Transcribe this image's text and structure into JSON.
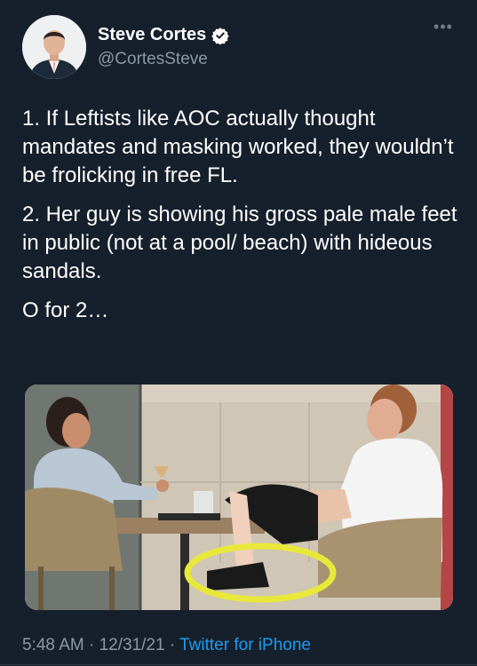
{
  "author": {
    "display_name": "Steve Cortes",
    "handle": "@CortesSteve",
    "verified": true,
    "verified_icon": "verified-badge-icon"
  },
  "tweet": {
    "paragraphs": [
      "1. If Leftists like AOC actually thought mandates and masking worked, they wouldn’t be frolicking in free FL.",
      "2. Her guy is showing his gross pale male feet in public (not at a pool/ beach) with hideous sandals.",
      "O for 2…"
    ]
  },
  "meta": {
    "time": "5:48 AM",
    "sep1": " · ",
    "date": "12/31/21",
    "sep2": " · ",
    "source": "Twitter for iPhone"
  },
  "colors": {
    "background": "#16202c",
    "secondary_text": "#8b98a5",
    "link": "#1d9bf0",
    "highlight_circle": "#e8e83a"
  },
  "icons": {
    "more": "more-horizontal-icon"
  }
}
